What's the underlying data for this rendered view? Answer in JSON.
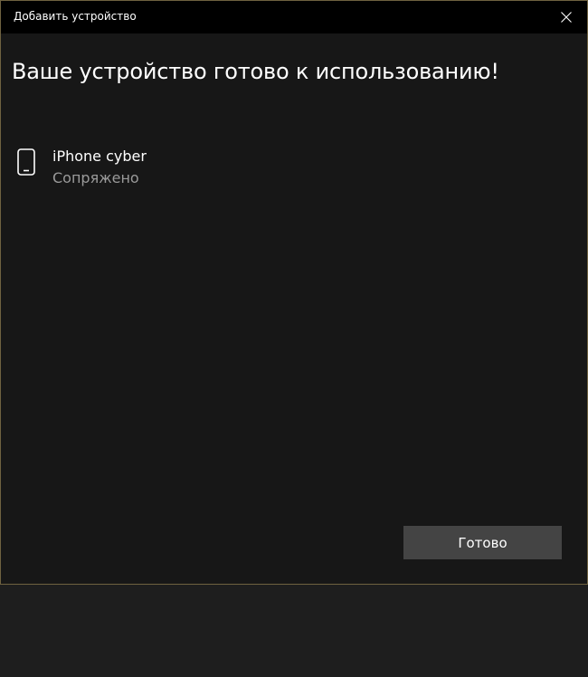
{
  "window": {
    "title": "Добавить устройство",
    "close_icon": "close-icon"
  },
  "main": {
    "heading": "Ваше устройство готово к использованию!",
    "device": {
      "icon": "phone-icon",
      "name": "iPhone cyber",
      "status": "Сопряжено"
    },
    "done_label": "Готово"
  },
  "colors": {
    "background": "#171717",
    "titlebar": "#000000",
    "border_accent": "#6f6240",
    "button": "#444444",
    "secondary_text": "#9a9a9a"
  }
}
